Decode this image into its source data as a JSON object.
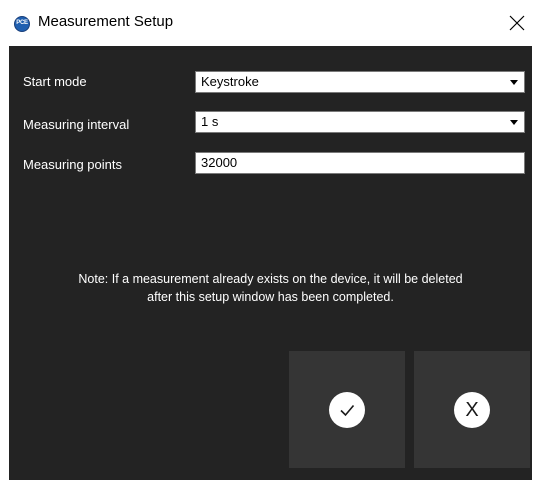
{
  "window": {
    "title": "Measurement Setup",
    "icon": "pce-logo-icon",
    "icon_text": "PCE"
  },
  "form": {
    "start_mode": {
      "label": "Start mode",
      "value": "Keystroke"
    },
    "measuring_interval": {
      "label": "Measuring interval",
      "value": "1 s"
    },
    "measuring_points": {
      "label": "Measuring points",
      "value": "32000"
    }
  },
  "note": {
    "line1": "Note: If a measurement already exists on the device, it will be deleted",
    "line2": "after this setup window has been completed."
  },
  "actions": {
    "confirm_icon": "checkmark-icon",
    "cancel_icon": "x-icon",
    "cancel_glyph": "X"
  },
  "colors": {
    "background": "#232323",
    "button": "#353535",
    "text": "#ffffff"
  }
}
